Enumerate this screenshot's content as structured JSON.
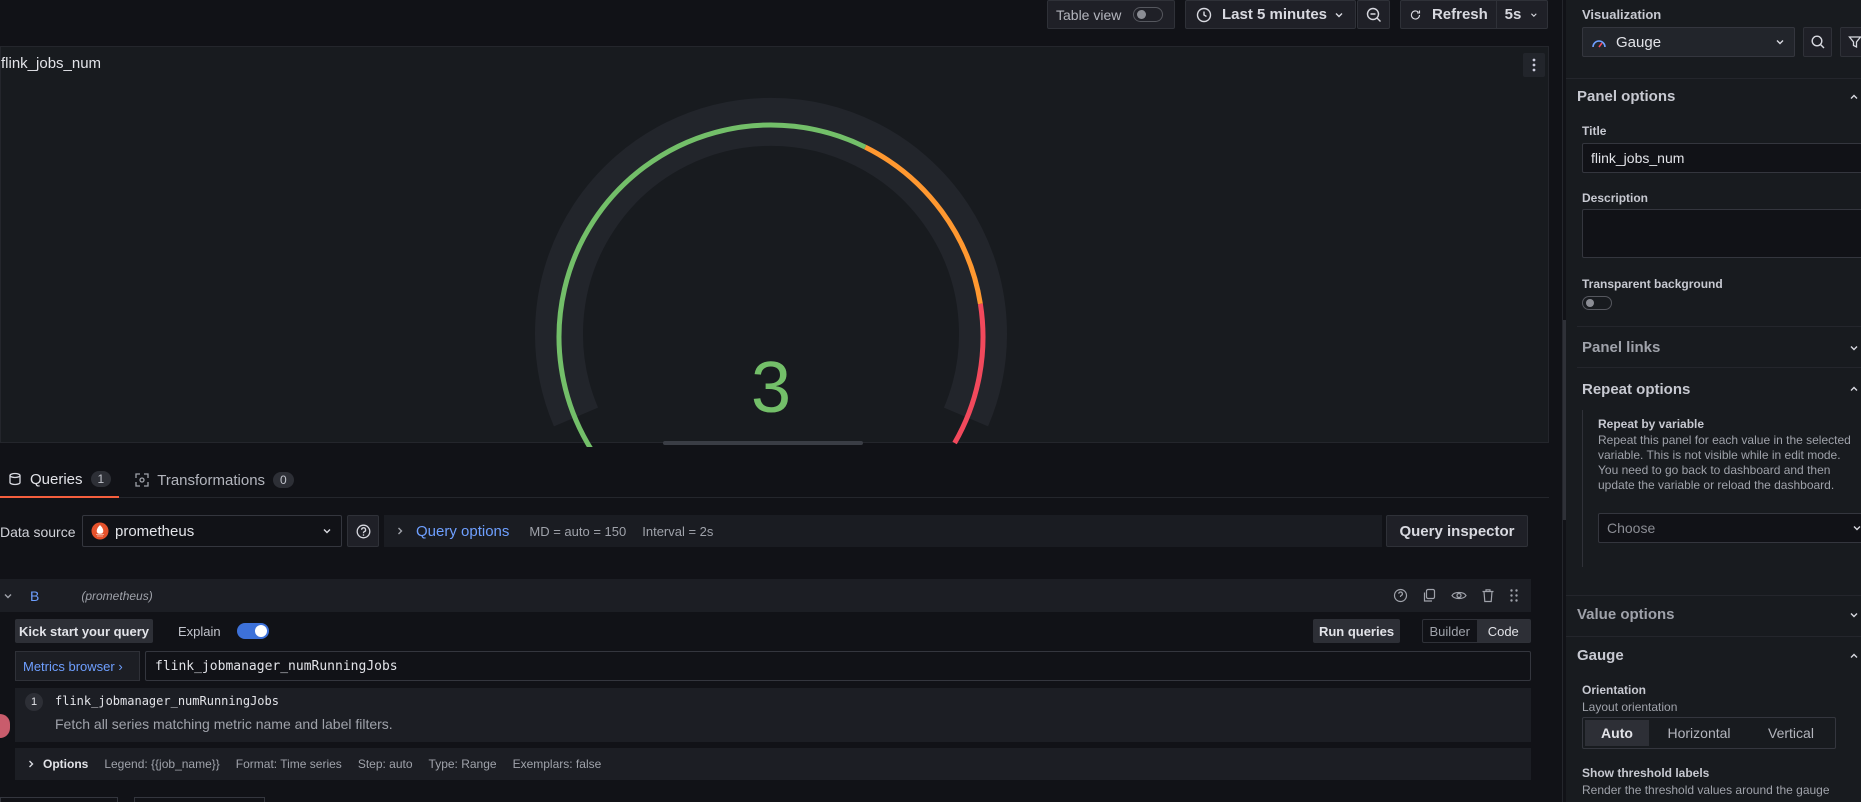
{
  "toolbar": {
    "table_view_label": "Table view",
    "time_range_label": "Last 5 minutes",
    "refresh_label": "Refresh",
    "refresh_interval": "5s"
  },
  "panel": {
    "title": "flink_jobs_num",
    "gauge_value": "3",
    "gauge_max": 4,
    "colors": {
      "green": "#73bf69",
      "orange": "#ff9830",
      "red": "#f2495c",
      "track": "#22252b"
    }
  },
  "query_tabs": {
    "queries_label": "Queries",
    "queries_count": "1",
    "transformations_label": "Transformations",
    "transformations_count": "0"
  },
  "datasource": {
    "label": "Data source",
    "value": "prometheus",
    "query_options_label": "Query options",
    "md_text": "MD = auto = 150",
    "interval_text": "Interval = 2s",
    "query_inspector_label": "Query inspector"
  },
  "query": {
    "ref_id": "B",
    "datasource_hint": "(prometheus)",
    "kick_start_label": "Kick start your query",
    "explain_label": "Explain",
    "run_queries_label": "Run queries",
    "builder_label": "Builder",
    "code_label": "Code",
    "metrics_browser_label": "Metrics browser ›",
    "expression": "flink_jobmanager_numRunningJobs",
    "suggestion_index": "1",
    "suggestion_metric": "flink_jobmanager_numRunningJobs",
    "suggestion_help": "Fetch all series matching metric name and label filters.",
    "options_label": "Options",
    "legend_text": "Legend: {{job_name}}",
    "format_text": "Format: Time series",
    "step_text": "Step: auto",
    "type_text": "Type: Range",
    "exemplars_text": "Exemplars: false"
  },
  "sidebar": {
    "visualization_label": "Visualization",
    "visualization_value": "Gauge",
    "panel_options_label": "Panel options",
    "title_label": "Title",
    "title_value": "flink_jobs_num",
    "description_label": "Description",
    "transparent_label": "Transparent background",
    "panel_links_label": "Panel links",
    "repeat_options_label": "Repeat options",
    "repeat_by_label": "Repeat by variable",
    "repeat_help": "Repeat this panel for each value in the selected variable. This is not visible while in edit mode. You need to go back to dashboard and then update the variable or reload the dashboard.",
    "repeat_choose": "Choose",
    "value_options_label": "Value options",
    "gauge_label": "Gauge",
    "orientation_label": "Orientation",
    "orientation_help": "Layout orientation",
    "orientation_options": [
      "Auto",
      "Horizontal",
      "Vertical"
    ],
    "show_threshold_labels": "Show threshold labels",
    "threshold_help": "Render the threshold values around the gauge"
  }
}
